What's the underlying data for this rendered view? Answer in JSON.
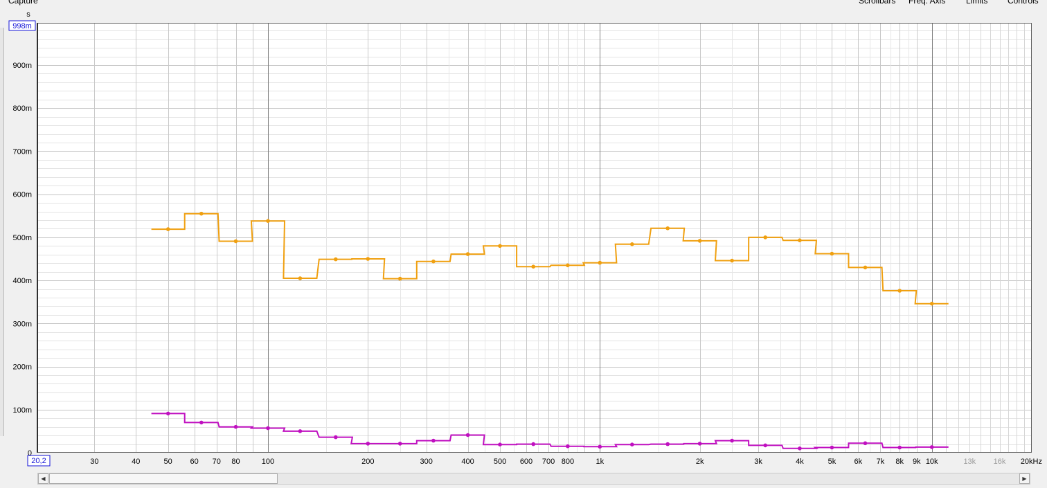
{
  "header": {
    "capture_label": "Capture",
    "menu": [
      "Scrollbars",
      "Freq. Axis",
      "Limits",
      "Controls"
    ]
  },
  "colors": {
    "series1": "#f0a010",
    "series2": "#c010c0",
    "plot_bg": "#ffffff",
    "marker": "#1515d8"
  },
  "chart_data": {
    "type": "line",
    "ylabel": "s",
    "xscale": "log",
    "xlim": [
      20.2,
      20000
    ],
    "ylim": [
      0,
      0.998
    ],
    "ytick_labels": [
      "0",
      "100m",
      "200m",
      "300m",
      "400m",
      "500m",
      "600m",
      "700m",
      "800m",
      "900m"
    ],
    "ytop_marker": "998m",
    "xstart_marker": "20,2",
    "xticks": [
      {
        "v": 30,
        "l": "30"
      },
      {
        "v": 40,
        "l": "40"
      },
      {
        "v": 50,
        "l": "50"
      },
      {
        "v": 60,
        "l": "60"
      },
      {
        "v": 70,
        "l": "70"
      },
      {
        "v": 80,
        "l": "80"
      },
      {
        "v": 100,
        "l": "100"
      },
      {
        "v": 200,
        "l": "200"
      },
      {
        "v": 300,
        "l": "300"
      },
      {
        "v": 400,
        "l": "400"
      },
      {
        "v": 500,
        "l": "500"
      },
      {
        "v": 600,
        "l": "600"
      },
      {
        "v": 700,
        "l": "700"
      },
      {
        "v": 800,
        "l": "800"
      },
      {
        "v": 1000,
        "l": "1k"
      },
      {
        "v": 2000,
        "l": "2k"
      },
      {
        "v": 3000,
        "l": "3k"
      },
      {
        "v": 4000,
        "l": "4k"
      },
      {
        "v": 5000,
        "l": "5k"
      },
      {
        "v": 6000,
        "l": "6k"
      },
      {
        "v": 7000,
        "l": "7k"
      },
      {
        "v": 8000,
        "l": "8k"
      },
      {
        "v": 9000,
        "l": "9k"
      },
      {
        "v": 10000,
        "l": "10k"
      },
      {
        "v": 13000,
        "l": "13k",
        "dim": true
      },
      {
        "v": 16000,
        "l": "16k",
        "dim": true
      },
      {
        "v": 20000,
        "l": "20kHz"
      }
    ],
    "x": [
      50,
      63,
      80,
      100,
      125,
      160,
      200,
      250,
      315,
      400,
      500,
      630,
      800,
      1000,
      1250,
      1600,
      2000,
      2500,
      3150,
      4000,
      5000,
      6300,
      8000,
      10000
    ],
    "series": [
      {
        "values": [
          0.519,
          0.555,
          0.491,
          0.538,
          0.405,
          0.449,
          0.45,
          0.404,
          0.444,
          0.461,
          0.48,
          0.432,
          0.435,
          0.441,
          0.484,
          0.521,
          0.492,
          0.446,
          0.5,
          0.493,
          0.462,
          0.43,
          0.376,
          0.346
        ]
      },
      {
        "values": [
          0.091,
          0.07,
          0.06,
          0.057,
          0.05,
          0.036,
          0.021,
          0.021,
          0.028,
          0.041,
          0.019,
          0.02,
          0.015,
          0.014,
          0.019,
          0.02,
          0.021,
          0.028,
          0.017,
          0.01,
          0.012,
          0.022,
          0.012,
          0.013
        ]
      }
    ]
  }
}
